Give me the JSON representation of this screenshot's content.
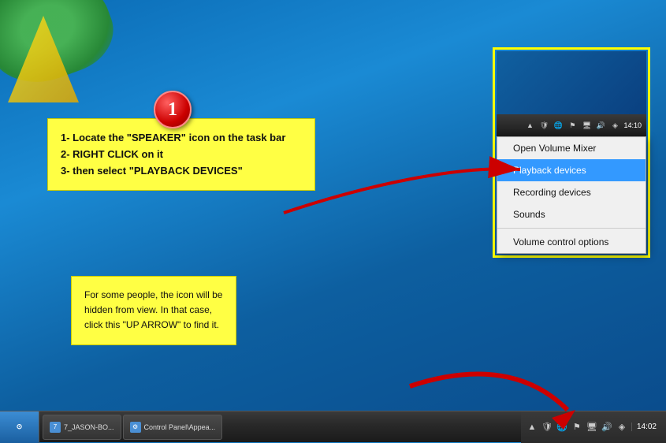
{
  "desktop": {
    "background": "Windows 7 blue gradient"
  },
  "step_circle": {
    "number": "1"
  },
  "instruction_box_1": {
    "line1": "1- Locate the \"SPEAKER\" icon on the task bar",
    "line2": "2- RIGHT CLICK on it",
    "line3": "3- then select \"PLAYBACK DEVICES\""
  },
  "instruction_box_2": {
    "text": "For some people, the icon will be hidden from view. In that case, click this \"UP ARROW\" to find it."
  },
  "context_menu": {
    "items": [
      {
        "label": "Open Volume Mixer",
        "highlighted": false
      },
      {
        "label": "Playback devices",
        "highlighted": true
      },
      {
        "label": "Recording devices",
        "highlighted": false
      },
      {
        "label": "Sounds",
        "highlighted": false
      },
      {
        "label": "Volume control options",
        "highlighted": false
      }
    ]
  },
  "taskbar": {
    "start_label": "Start",
    "items": [
      {
        "label": "7_JASON-BO..."
      },
      {
        "label": "Control Panel\\Appea..."
      }
    ],
    "clock": "14:02"
  },
  "mini_clock": "14:10"
}
